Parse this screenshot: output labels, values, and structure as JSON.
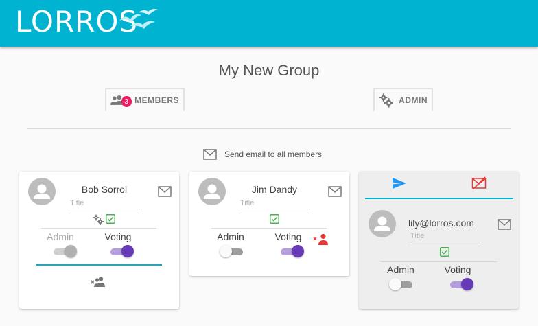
{
  "app": {
    "logo_text": "LORROS"
  },
  "page": {
    "title": "My New Group"
  },
  "tabs": {
    "members": {
      "label": "MEMBERS",
      "count": "3"
    },
    "admin": {
      "label": "ADMIN"
    }
  },
  "actions": {
    "email_all_label": "Send email to all members"
  },
  "members": [
    {
      "name": "Bob Sorrol",
      "title_placeholder": "Title",
      "admin_label": "Admin",
      "voting_label": "Voting",
      "admin_on": true,
      "admin_disabled": true,
      "voting_on": true
    },
    {
      "name": "Jim Dandy",
      "title_placeholder": "Title",
      "admin_label": "Admin",
      "voting_label": "Voting",
      "admin_on": false,
      "voting_on": true
    },
    {
      "name": "lily@lorros.com",
      "title_placeholder": "Title",
      "admin_label": "Admin",
      "voting_label": "Voting",
      "admin_on": false,
      "voting_on": true,
      "invitation_pending": true
    }
  ],
  "colors": {
    "brand": "#00b4d1",
    "badge": "#e91e63",
    "toggle_on": "#673ab7",
    "check": "#4caf50",
    "remove": "#e53935",
    "send": "#2196f3"
  }
}
